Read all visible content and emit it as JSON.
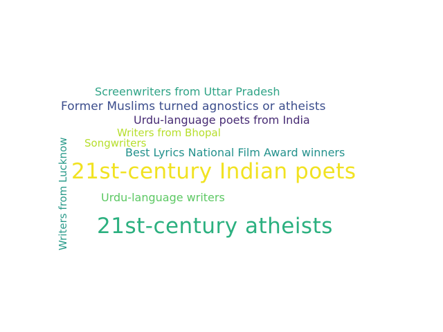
{
  "words": [
    {
      "text": "Screenwriters from Uttar Pradesh",
      "color": "#2fa386"
    },
    {
      "text": "Former Muslims turned agnostics or atheists",
      "color": "#3b4d8c"
    },
    {
      "text": "Urdu-language poets from India",
      "color": "#462a73"
    },
    {
      "text": "Writers from Bhopal",
      "color": "#b6de2b"
    },
    {
      "text": "Songwriters",
      "color": "#b6de2b"
    },
    {
      "text": "Best Lyrics National Film Award winners",
      "color": "#23918c"
    },
    {
      "text": "21st-century Indian poets",
      "color": "#f1e221"
    },
    {
      "text": "Urdu-language writers",
      "color": "#5cc863"
    },
    {
      "text": "21st-century atheists",
      "color": "#2bb07f"
    },
    {
      "text": "Writers from Lucknow",
      "color": "#2a9a8a"
    }
  ]
}
